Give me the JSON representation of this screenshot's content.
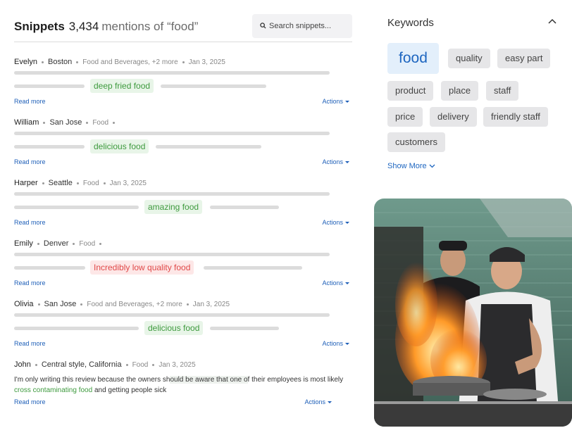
{
  "header": {
    "title": "Snippets",
    "count": "3,434",
    "mentions_label": "mentions of “food”",
    "search_placeholder": "Search snippets..."
  },
  "snippets": [
    {
      "name": "Evelyn",
      "city": "Boston",
      "category": "Food and Beverages, +2 more",
      "date": "Jan 3, 2025",
      "highlight": "deep fried food",
      "sentiment": "positive",
      "read_more": "Read more",
      "actions": "Actions"
    },
    {
      "name": "William",
      "city": "San Jose",
      "category": "Food",
      "date": "",
      "highlight": "delicious food",
      "sentiment": "positive",
      "read_more": "Read more",
      "actions": "Actions"
    },
    {
      "name": "Harper",
      "city": "Seattle",
      "category": "Food",
      "date": "Jan 3, 2025",
      "highlight": "amazing food",
      "sentiment": "positive",
      "read_more": "Read more",
      "actions": "Actions"
    },
    {
      "name": "Emily",
      "city": "Denver",
      "category": "Food",
      "date": "",
      "highlight": "Incredibly low quality food",
      "sentiment": "negative",
      "read_more": "Read more",
      "actions": "Actions"
    },
    {
      "name": "Olivia",
      "city": "San Jose",
      "category": "Food and Beverages, +2 more",
      "date": "Jan 3, 2025",
      "highlight": "delicious food",
      "sentiment": "positive",
      "read_more": "Read more",
      "actions": "Actions"
    }
  ],
  "expanded_snippet": {
    "name": "John",
    "city": "Central style, California",
    "category": "Food",
    "date": "Jan 3, 2025",
    "text_part1": "I'm only writing this review because the owners sh",
    "text_shaded": "ould be aware that one o",
    "text_part2": "f their employees is most likely ",
    "text_green": "cross contaminating food",
    "text_part3": " and getting people sick",
    "read_more": "Read more",
    "actions": "Actions"
  },
  "keywords": {
    "title": "Keywords",
    "tags": [
      "food",
      "quality",
      "easy part",
      "product",
      "place",
      "staff",
      "price",
      "delivery",
      "friendly staff",
      "customers"
    ],
    "show_more": "Show More"
  },
  "colors": {
    "positive": "#3e9a3e",
    "positive_bg": "#e8f5e8",
    "negative": "#e04848",
    "negative_bg": "#fde7e7",
    "link": "#1e5fb8",
    "tag_active_bg": "#e3effb"
  }
}
